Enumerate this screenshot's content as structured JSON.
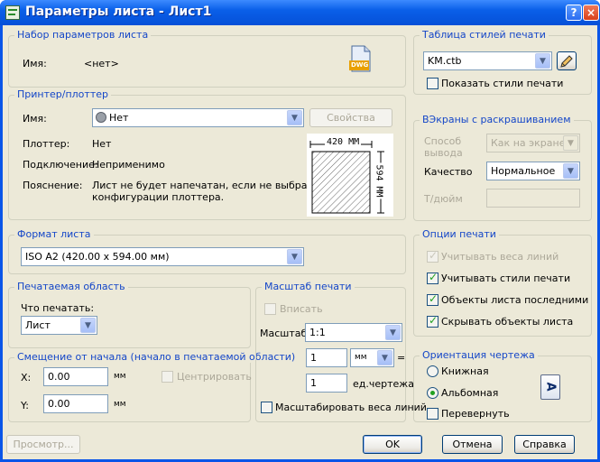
{
  "window": {
    "title": "Параметры листа - Лист1"
  },
  "page_setup": {
    "title": "Набор параметров листа",
    "name_label": "Имя:",
    "name_value": "<нет>",
    "file_icon_text": "DWG"
  },
  "printer": {
    "title": "Принтер/плоттер",
    "name_label": "Имя:",
    "name_value": "Нет",
    "properties_button": "Свойства",
    "plotter_label": "Плоттер:",
    "plotter_value": "Нет",
    "connection_label": "Подключение:",
    "connection_value": "Неприменимо",
    "description_label": "Пояснение:",
    "description_line1": "Лист не будет напечатан, если не выбрать имя",
    "description_line2": "конфигурации плоттера.",
    "preview_width": "420 MM",
    "preview_height": "594 MM"
  },
  "paper_size": {
    "title": "Формат листа",
    "value": "ISO A2 (420.00 x 594.00 мм)"
  },
  "plot_area": {
    "title": "Печатаемая область",
    "what_label": "Что печатать:",
    "what_value": "Лист"
  },
  "plot_offset": {
    "title": "Смещение от начала (начало в печатаемой области)",
    "x_label": "X:",
    "x_value": "0.00",
    "x_unit": "мм",
    "y_label": "Y:",
    "y_value": "0.00",
    "y_unit": "мм",
    "center_label": "Центрировать"
  },
  "plot_scale": {
    "title": "Масштаб печати",
    "fit_label": "Вписать",
    "scale_label": "Масштаб:",
    "scale_value": "1:1",
    "value1": "1",
    "unit_value": "мм",
    "equals": "=",
    "value2": "1",
    "drawing_units": "ед.чертежа",
    "scale_lineweights_label": "Масштабировать веса линий"
  },
  "style_table": {
    "title": "Таблица стилей печати",
    "value": "KM.ctb",
    "show_styles_label": "Показать стили печати"
  },
  "shaded_viewport": {
    "title": "ВЭкраны с раскрашиванием",
    "shade_label_line1": "Способ",
    "shade_label_line2": "вывода",
    "shade_value": "Как на экране",
    "quality_label": "Качество",
    "quality_value": "Нормальное",
    "dpi_label": "Т/дюйм"
  },
  "plot_options": {
    "title": "Опции печати",
    "lineweights_label": "Учитывать веса линий",
    "lineweights_checked": true,
    "styles_label": "Учитывать стили печати",
    "styles_checked": true,
    "paperspace_last_label": "Объекты листа последними",
    "paperspace_last_checked": true,
    "hide_objects_label": "Скрывать объекты листа",
    "hide_objects_checked": true
  },
  "orientation": {
    "title": "Ориентация чертежа",
    "portrait_label": "Книжная",
    "landscape_label": "Альбомная",
    "upside_down_label": "Перевернуть",
    "selected": "Альбомная",
    "orientation_glyph": "A"
  },
  "footer": {
    "preview_button": "Просмотр...",
    "ok_button": "OK",
    "cancel_button": "Отмена",
    "help_button": "Справка"
  },
  "colors": {
    "titlebar": "#0a55e8",
    "group_title": "#1446c8",
    "dialog_bg": "#ece9d8",
    "check_mark": "#21a121"
  }
}
